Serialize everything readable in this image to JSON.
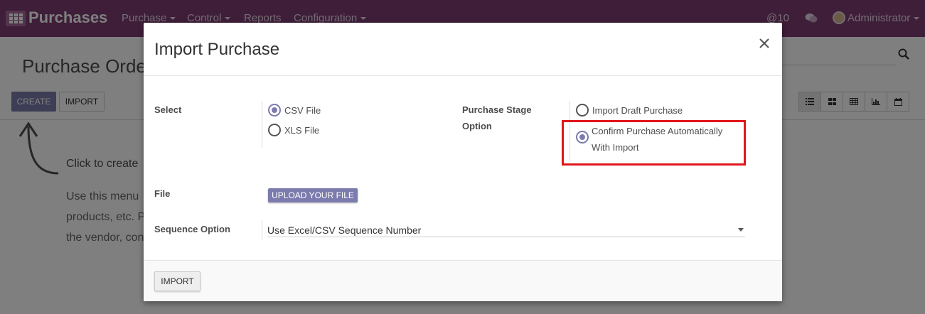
{
  "navbar": {
    "app_name": "Purchases",
    "menus": [
      "Purchase",
      "Control",
      "Reports",
      "Configuration"
    ],
    "mentions": "@10",
    "user": "Administrator",
    "brand_color": "#7c3d73"
  },
  "control_panel": {
    "title": "Purchase Order",
    "create_label": "CREATE",
    "import_label": "IMPORT"
  },
  "help": {
    "title": "Click to create",
    "lines": [
      "Use this menu",
      "products, etc. P",
      "the vendor, con"
    ]
  },
  "dialog": {
    "title": "Import Purchase",
    "select_label": "Select",
    "file_types": [
      {
        "label": "CSV File",
        "checked": true
      },
      {
        "label": "XLS File",
        "checked": false
      }
    ],
    "stage_label_line1": "Purchase Stage",
    "stage_label_line2": "Option",
    "stage_options": [
      {
        "label": "Import Draft Purchase",
        "checked": false
      },
      {
        "label_line1": "Confirm Purchase Automatically",
        "label_line2": "With Import",
        "checked": true
      }
    ],
    "file_label": "File",
    "upload_label": "UPLOAD YOUR FILE",
    "sequence_label": "Sequence Option",
    "sequence_value": "Use Excel/CSV Sequence Number",
    "import_button": "IMPORT",
    "accent_color": "#7c7bad",
    "highlight_color": "#e0161b"
  }
}
